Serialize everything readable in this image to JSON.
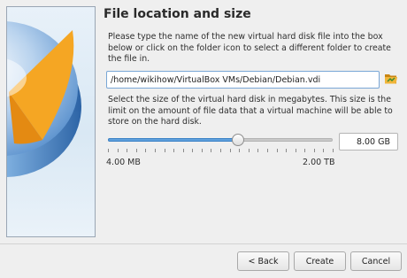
{
  "wizard": {
    "title": "File location and size",
    "location_instructions": "Please type the name of the new virtual hard disk file into the box below or click on the folder icon to select a different folder to create the file in.",
    "file_path": "/home/wikihow/VirtualBox VMs/Debian/Debian.vdi",
    "folder_icon": "folder-open-icon",
    "size_instructions": "Select the size of the virtual hard disk in megabytes. This size is the limit on the amount of file data that a virtual machine will be able to store on the hard disk.",
    "size": {
      "value": "8.00 GB",
      "min_label": "4.00 MB",
      "max_label": "2.00 TB",
      "slider_fraction": 0.58
    }
  },
  "buttons": {
    "back": "< Back",
    "create": "Create",
    "cancel": "Cancel"
  },
  "colors": {
    "accent": "#3b82c6",
    "input_focus_border": "#7aa7d6",
    "folder_icon": "#e8a020",
    "window_bg": "#efefef"
  }
}
